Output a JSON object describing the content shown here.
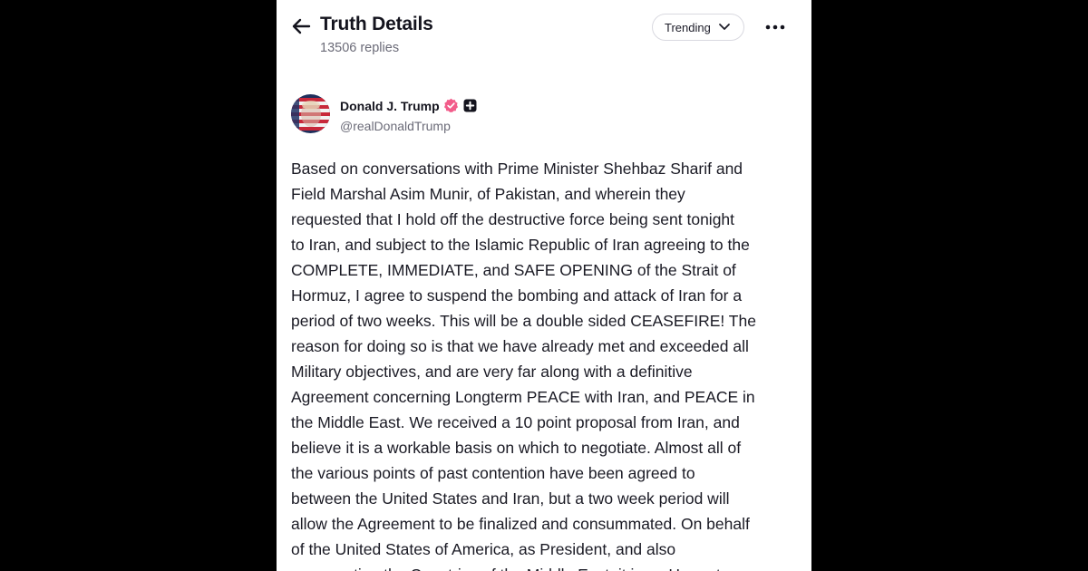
{
  "header": {
    "title": "Truth Details",
    "replies": "13506 replies",
    "sort_label": "Trending"
  },
  "author": {
    "name": "Donald J. Trump",
    "handle": "@realDonaldTrump",
    "verified_color": "#f25c8a"
  },
  "post": {
    "lines": [
      "Based on conversations with Prime Minister Shehbaz Sharif and",
      "Field Marshal Asim Munir, of Pakistan, and wherein they",
      "requested that I hold off the destructive force being sent tonight",
      "to Iran, and subject to the Islamic Republic of Iran agreeing to the",
      "COMPLETE, IMMEDIATE, and SAFE OPENING of the Strait of",
      "Hormuz, I agree to suspend the bombing and attack of Iran for a",
      "period of two weeks. This will be a double sided CEASEFIRE! The",
      "reason for doing so is that we have already met and exceeded all",
      "Military objectives, and are very far along with a definitive",
      "Agreement concerning Longterm PEACE with Iran, and PEACE in",
      "the Middle East. We received a 10 point proposal from Iran, and",
      "believe it is a workable basis on which to negotiate. Almost all of",
      "the various points of past contention have been agreed to",
      "between the United States and Iran, but a two week period will",
      "allow the Agreement to be finalized and consummated. On behalf",
      "of the United States of America, as President, and also",
      "representing the Countries of the Middle East, it is an Honor to"
    ]
  }
}
